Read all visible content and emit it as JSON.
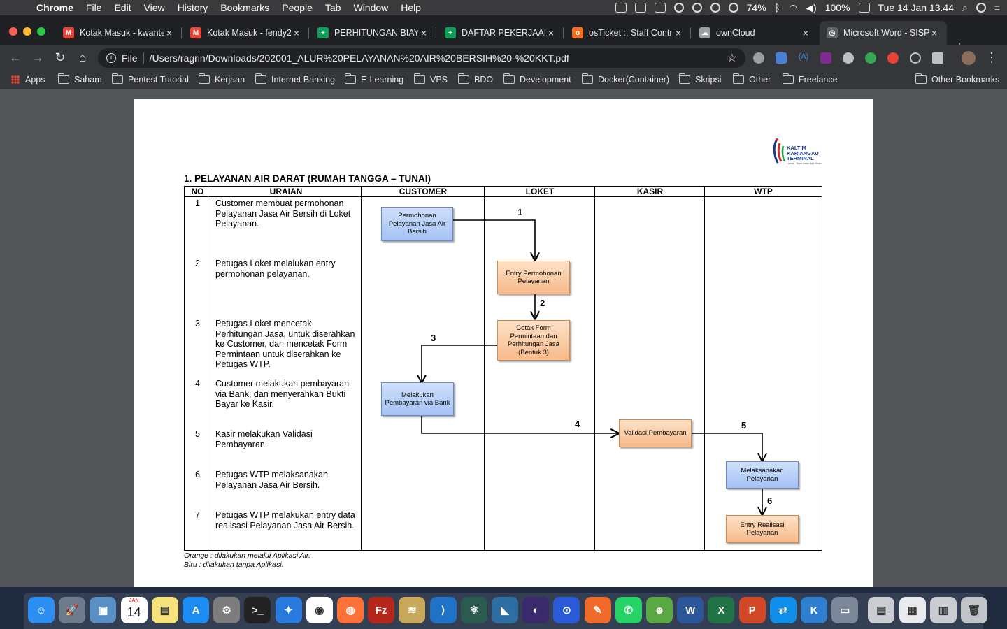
{
  "menubar": {
    "app": "Chrome",
    "items": [
      "File",
      "Edit",
      "View",
      "History",
      "Bookmarks",
      "People",
      "Tab",
      "Window",
      "Help"
    ],
    "battery": "74%",
    "zoom": "100%",
    "datetime": "Tue 14 Jan  13.44"
  },
  "tabs": [
    {
      "label": "Kotak Masuk - kwante",
      "favicon": "gmail-icon",
      "color": "#ea4335",
      "glyph": "M"
    },
    {
      "label": "Kotak Masuk - fendy2",
      "favicon": "gmail-icon",
      "color": "#ea4335",
      "glyph": "M"
    },
    {
      "label": "PERHITUNGAN BIAYA",
      "favicon": "sheets-icon",
      "color": "#0f9d58",
      "glyph": "+"
    },
    {
      "label": "DAFTAR PEKERJAAN",
      "favicon": "sheets-icon",
      "color": "#0f9d58",
      "glyph": "+"
    },
    {
      "label": "osTicket :: Staff Contr",
      "favicon": "osticket-icon",
      "color": "#f36f21",
      "glyph": "o"
    },
    {
      "label": "ownCloud",
      "favicon": "cloud-icon",
      "color": "#9aa0a6",
      "glyph": "☁"
    },
    {
      "label": "Microsoft Word - SISP",
      "favicon": "globe-icon",
      "color": "#5f6368",
      "glyph": "◎"
    }
  ],
  "toolbar": {
    "file_label": "File",
    "url": "/Users/ragrin/Downloads/202001_ALUR%20PELAYANAN%20AIR%20BERSIH%20-%20KKT.pdf"
  },
  "bookmarks": [
    "Apps",
    "Saham",
    "Pentest Tutorial",
    "Kerjaan",
    "Internet Banking",
    "E-Learning",
    "VPS",
    "BDO",
    "Development",
    "Docker(Container)",
    "Skripsi",
    "Other",
    "Freelance"
  ],
  "other_bookmarks": "Other Bookmarks",
  "document": {
    "logo": {
      "line1": "KALTIM",
      "line2": "KARIANGAU",
      "line3": "TERMINAL",
      "tagline": "Lancar . Tepat waktu dan Efisien"
    },
    "title": "1. PELAYANAN AIR DARAT (RUMAH TANGGA – TUNAI)",
    "columns": [
      "NO",
      "URAIAN",
      "CUSTOMER",
      "LOKET",
      "KASIR",
      "WTP"
    ],
    "steps": [
      {
        "no": "1",
        "text": "Customer membuat permohonan Pelayanan Jasa Air Bersih di Loket Pelayanan."
      },
      {
        "no": "2",
        "text": "Petugas Loket melalukan entry permohonan pelayanan."
      },
      {
        "no": "3",
        "text": "Petugas Loket mencetak Perhitungan Jasa, untuk diserahkan ke Customer, dan mencetak Form Permintaan untuk diserahkan ke Petugas WTP."
      },
      {
        "no": "4",
        "text": "Customer melakukan pembayaran via Bank, dan menyerahkan Bukti Bayar ke Kasir."
      },
      {
        "no": "5",
        "text": "Kasir melakukan Validasi Pembayaran."
      },
      {
        "no": "6",
        "text": "Petugas WTP melaksanakan Pelayanan Jasa Air Bersih."
      },
      {
        "no": "7",
        "text": "Petugas WTP melakukan entry data realisasi Pelayanan Jasa Air Bersih."
      }
    ],
    "boxes": {
      "permohonan": "Permohonan Pelayanan Jasa Air Bersih",
      "entry": "Entry Permohonan Pelayanan",
      "cetak": "Cetak Form Permintaan dan Perhitungan Jasa (Bentuk 3)",
      "bayar": "Melakukan Pembayaran via Bank",
      "validasi": "Validasi Pembayaran",
      "laksana": "Melaksanakan Pelayanan",
      "realisasi": "Entry Realisasi Pelayanan"
    },
    "arrow_labels": [
      "1",
      "2",
      "3",
      "4",
      "5",
      "6"
    ],
    "legend_orange": "Orange : dilakukan melalui Aplikasi Air.",
    "legend_blue": "Biru : dilakukan tanpa Aplikasi.",
    "colors": {
      "blue_box": "#a4c2f4",
      "orange_box": "#f7b98a"
    }
  },
  "dock": {
    "calendar_month": "JAN",
    "calendar_day": "14",
    "apps": [
      "Finder",
      "Launchpad",
      "Preview",
      "Calendar",
      "Notes",
      "App Store",
      "System Preferences",
      "Terminal",
      "Safari",
      "Chrome",
      "Firefox",
      "FileZilla",
      "Sequel Pro",
      "VS Code",
      "Atom",
      "MySQL Workbench",
      "Eclipse",
      "Maps",
      "Postman",
      "WhatsApp",
      "Android File Transfer",
      "Word",
      "Excel",
      "PowerPoint",
      "TeamViewer",
      "KeyShot",
      "Image Capture",
      "Downloads",
      "Documents",
      "Stack",
      "Trash"
    ]
  }
}
